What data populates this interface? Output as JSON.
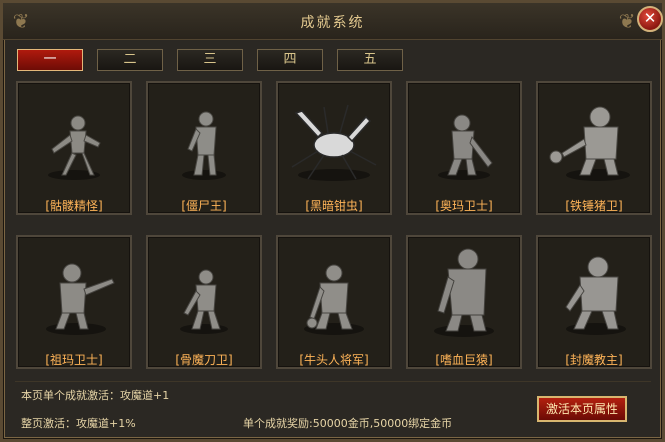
{
  "window": {
    "title": "成就系统"
  },
  "tabs": [
    {
      "label": "一",
      "active": true
    },
    {
      "label": "二",
      "active": false
    },
    {
      "label": "三",
      "active": false
    },
    {
      "label": "四",
      "active": false
    },
    {
      "label": "五",
      "active": false
    }
  ],
  "achievements": [
    {
      "name": "[骷髅精怪]",
      "icon": "skeleton-monster"
    },
    {
      "name": "[僵尸王]",
      "icon": "zombie-king"
    },
    {
      "name": "[黑暗钳虫]",
      "icon": "dark-pincer-bug"
    },
    {
      "name": "[奥玛卫士]",
      "icon": "oma-guard"
    },
    {
      "name": "[铁锤猪卫]",
      "icon": "iron-hammer-pig-guard"
    },
    {
      "name": "[祖玛卫士]",
      "icon": "zuma-guard"
    },
    {
      "name": "[骨魔刀卫]",
      "icon": "bone-demon-blade-guard"
    },
    {
      "name": "[牛头人将军]",
      "icon": "minotaur-general"
    },
    {
      "name": "[嗜血巨猿]",
      "icon": "bloodthirsty-giant-ape"
    },
    {
      "name": "[封魔教主]",
      "icon": "seal-demon-master"
    }
  ],
  "footer": {
    "single_activate": "本页单个成就激活：攻魔道+1",
    "page_activate": "整页激活：攻魔道+1%",
    "reward": "单个成就奖励:50000金币,50000绑定金币",
    "activate_button": "激活本页属性"
  },
  "colors": {
    "accent": "#b01a0e",
    "name_text": "#ffb458",
    "title": "#e3c98f"
  }
}
